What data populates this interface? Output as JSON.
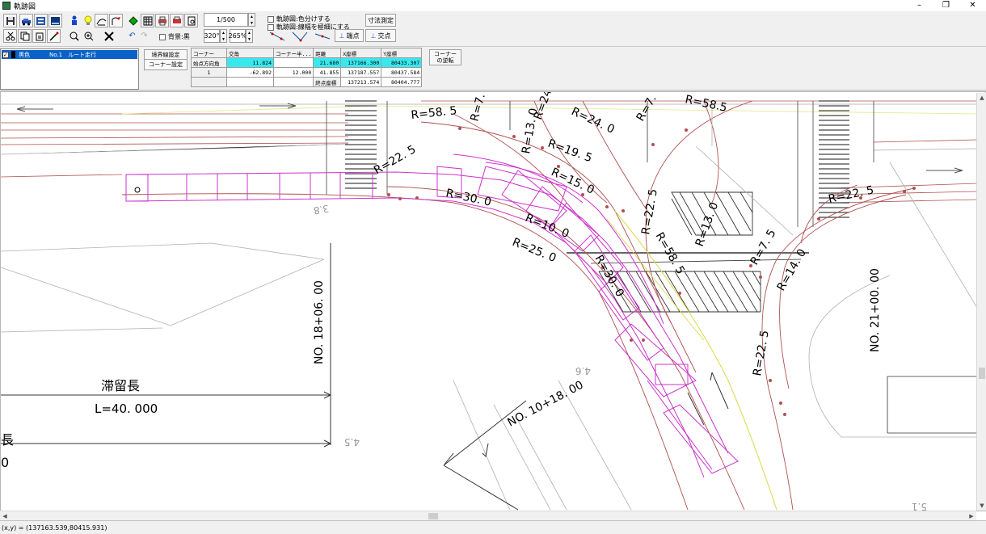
{
  "window": {
    "title": "軌跡図",
    "min": "–",
    "max": "❐",
    "close": "✕"
  },
  "toolbar": {
    "scale_value": "1/500",
    "angle_value": "320°",
    "zoom_value": "265%",
    "undo_icon": "↶",
    "redo_icon": "↷",
    "bg_black_label": "背景:黒",
    "color_split_label": "軌跡図:色分けする",
    "thin_line_label": "軌跡図:線幅を極細にする",
    "dimension_button": "寸法測定",
    "end_point_button": "端点",
    "intersection_button": "交点"
  },
  "layers": {
    "items": [
      {
        "color": "黒色",
        "name": "No.1　ルート走行",
        "checked": true
      }
    ]
  },
  "panel": {
    "boundary_button": "境界線設定",
    "corner_button": "コーナー設定",
    "reverse_button": "コーナー\nの逆転"
  },
  "corner_table": {
    "headers": [
      "コーナー",
      "交角",
      "コーナー半...",
      "距離",
      "X座標",
      "Y座標"
    ],
    "rows": [
      [
        "始点方向角",
        "11.824",
        "",
        "21.680",
        "137166.300",
        "80433.307"
      ],
      [
        "1",
        "-62.892",
        "12.000",
        "41.855",
        "137187.557",
        "80437.584"
      ],
      [
        "",
        "",
        "",
        "終点座標",
        "137213.574",
        "80404.777"
      ]
    ]
  },
  "drawing": {
    "labels": {
      "r585_top": "R=58. 5",
      "r75_top": "R=7. 5",
      "r13_top": "R=13. 0",
      "r24_top": "R=24. 0",
      "r24_b": "R=24. 0",
      "r7_b": "R=7.",
      "r585_b": "R=58.5",
      "r195": "R=19. 5",
      "r225_left": "R=22. 5",
      "r30_left": "R=30. 0",
      "r15": "R=15. 0",
      "r10": "R=10. 0",
      "r25": "R=25. 0",
      "r225_mid": "R=22. 5",
      "r585_mid": "R=58. 5",
      "r13_mid": "R=13. 0",
      "r30_mid": "R=30. 0",
      "r75_mid": "R=7. 5",
      "r14": "R=14. 0",
      "r225_right": "R=22. 5",
      "r225_low": "R=22. 5",
      "no18": "NO. 18+06. 00",
      "no21": "NO. 21+00. 00",
      "no10": "NO. 10+18. 00",
      "taiiryu": "滞留長",
      "l40": "L=40. 000",
      "cho": "長",
      "zero": "0",
      "n46": "4.6",
      "n45": "4.5",
      "n38": "3.8",
      "n51": "5.1"
    }
  },
  "status": {
    "coords": "(x,y) = (137163.539,80415.931)"
  }
}
